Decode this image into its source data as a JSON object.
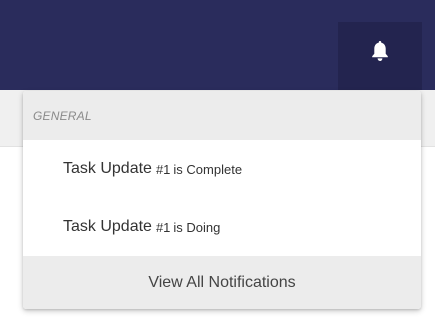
{
  "header": {
    "notifications_icon": "bell-icon",
    "background_color": "#2a2c5c"
  },
  "notifications": {
    "section_label": "GENERAL",
    "items": [
      {
        "title": "Task Update",
        "number": "#1",
        "status": "is Complete"
      },
      {
        "title": "Task Update",
        "number": "#1",
        "status": "is Doing"
      }
    ],
    "view_all_label": "View All Notifications"
  }
}
